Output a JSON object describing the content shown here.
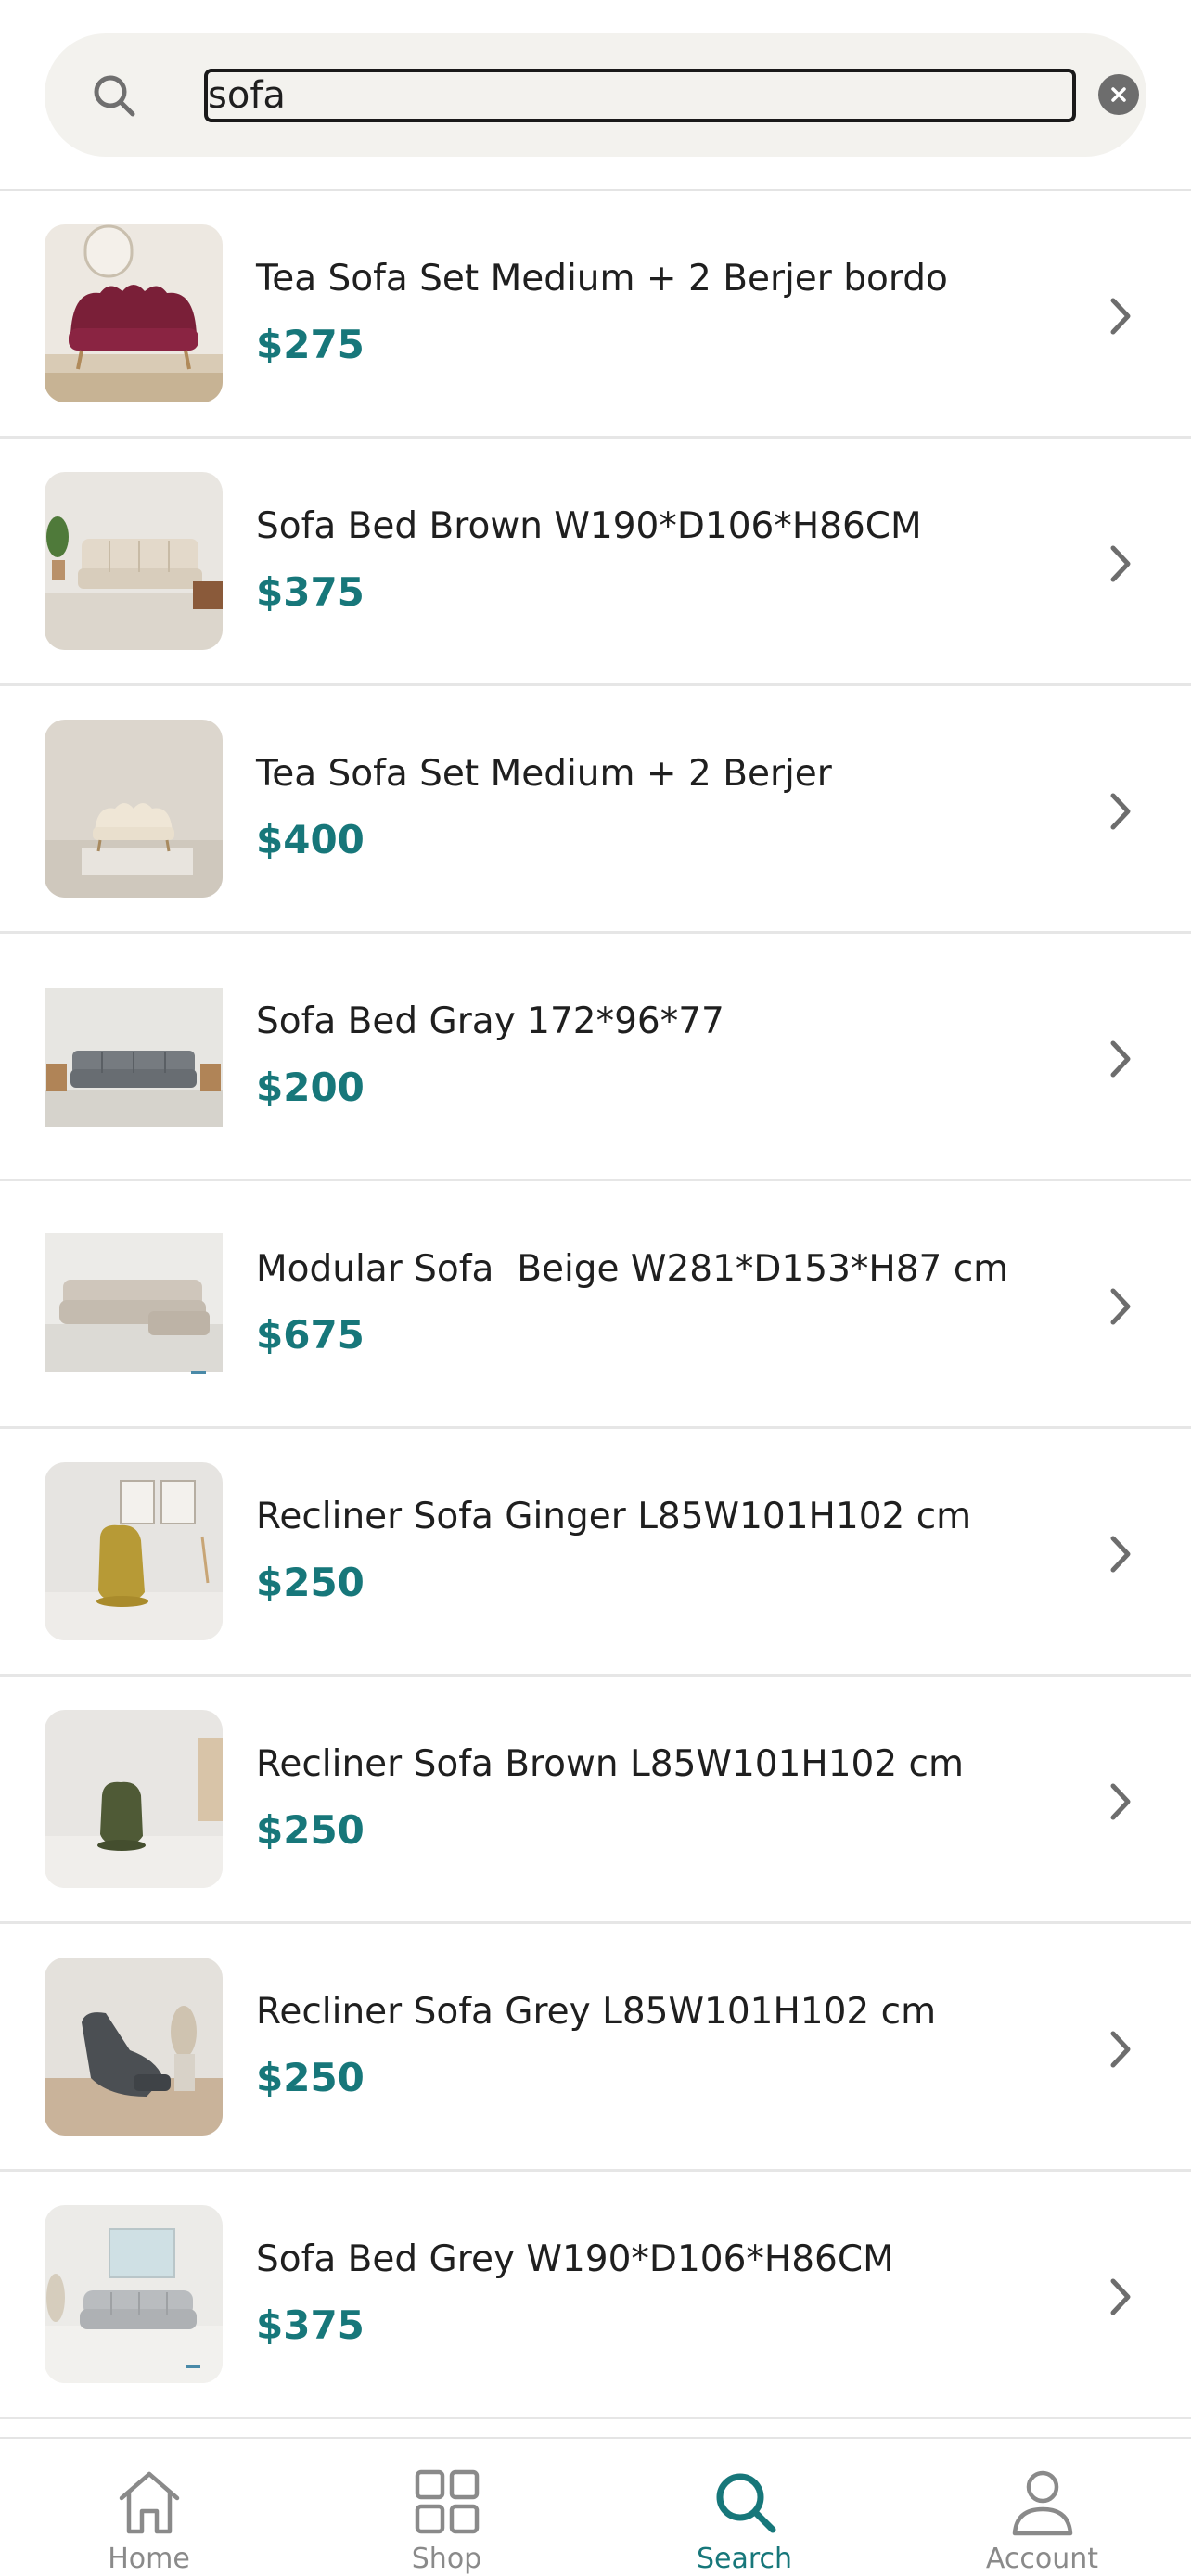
{
  "search": {
    "value": "sofa",
    "clear_label": "Clear"
  },
  "results": [
    {
      "title": "Tea Sofa Set Medium + 2 Berjer bordo",
      "price": "$275",
      "image": "burgundy-scallop-sofa"
    },
    {
      "title": "Sofa Bed Brown W190*D106*H86CM",
      "price": "$375",
      "image": "beige-tufted-sofa-bed"
    },
    {
      "title": "Tea Sofa Set Medium + 2 Berjer",
      "price": "$400",
      "image": "cream-scallop-sofa"
    },
    {
      "title": "Sofa Bed Gray 172*96*77",
      "price": "$200",
      "image": "gray-tufted-sofa-bed"
    },
    {
      "title": "Modular Sofa  Beige W281*D153*H87 cm",
      "price": "$675",
      "image": "beige-modular-sectional"
    },
    {
      "title": "Recliner Sofa Ginger L85W101H102 cm",
      "price": "$250",
      "image": "mustard-recliner-chair"
    },
    {
      "title": "Recliner Sofa Brown L85W101H102 cm",
      "price": "$250",
      "image": "olive-recliner-chair"
    },
    {
      "title": "Recliner Sofa Grey L85W101H102 cm",
      "price": "$250",
      "image": "charcoal-recliner-chair"
    },
    {
      "title": "Sofa Bed Grey W190*D106*H86CM",
      "price": "$375",
      "image": "light-gray-sofa-bed"
    }
  ],
  "tabs": [
    {
      "label": "Home",
      "icon": "home-icon",
      "active": false
    },
    {
      "label": "Shop",
      "icon": "grid-icon",
      "active": false
    },
    {
      "label": "Search",
      "icon": "search-icon",
      "active": true
    },
    {
      "label": "Account",
      "icon": "person-icon",
      "active": false
    }
  ],
  "colors": {
    "accent": "#17777a",
    "search_bar_bg": "#f3f2ee",
    "divider": "#e6e6e6",
    "inactive_tab": "#8a8a8a"
  }
}
